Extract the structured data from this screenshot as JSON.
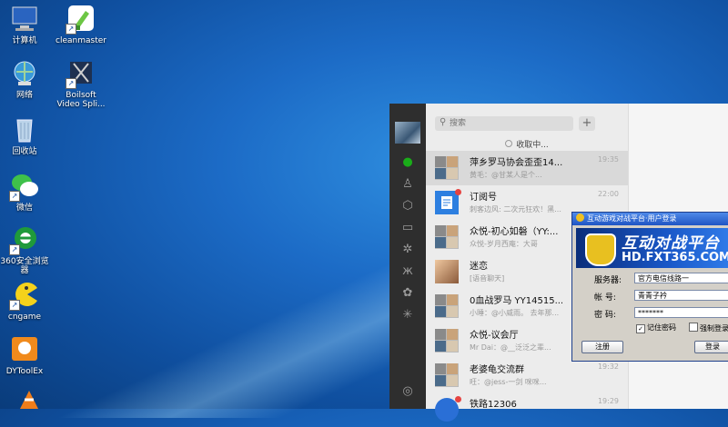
{
  "desktop": {
    "icons": [
      {
        "label": "计算机",
        "icon": "computer-icon"
      },
      {
        "label": "cleanmaster",
        "icon": "broom-icon"
      },
      {
        "label": "网络",
        "icon": "network-icon"
      },
      {
        "label": "Boilsoft\nVideo Spli...",
        "icon": "video-splitter-icon"
      },
      {
        "label": "回收站",
        "icon": "recycle-bin-icon"
      },
      {
        "label": "微信",
        "icon": "wechat-icon"
      },
      {
        "label": "360安全浏览\n器",
        "icon": "360-browser-icon"
      },
      {
        "label": "cngame",
        "icon": "pacman-icon"
      },
      {
        "label": "DYToolEx",
        "icon": "dytoolex-icon"
      }
    ]
  },
  "chat": {
    "search_placeholder": "搜索",
    "add_label": "+",
    "receiving": "收取中...",
    "conversations": [
      {
        "name": "萍乡罗马协会歪歪14...",
        "time": "19:35",
        "message": "黄毛：@甘某人是个...",
        "active": true
      },
      {
        "name": "订阅号",
        "time": "22:00",
        "message": "刺客边风: 二次元狂欢！黑... ",
        "badge": true
      },
      {
        "name": "众悦-初心如磐（YY:...",
        "time": "",
        "message": "众悦-岁月西庵：大哥"
      },
      {
        "name": "迷恋",
        "time": "",
        "message": "[语音聊天]"
      },
      {
        "name": "0血战罗马 YY14515...",
        "time": "",
        "message": "小睡：@小威雨。 去年那..."
      },
      {
        "name": "众悦-议会厅",
        "time": "",
        "message": "Mr Dai：@__泛泛之辈..."
      },
      {
        "name": "老婆龟交流群",
        "time": "19:32",
        "message": "旺：@jess-一剑 咪咪..."
      },
      {
        "name": "铁路12306",
        "time": "19:29",
        "message": ""
      }
    ]
  },
  "dialog": {
    "title": "互动游戏对战平台·用户登录",
    "banner_title": "互动对战平台",
    "banner_url": "HD.FXT365.COM",
    "server_label": "服务器:",
    "server_value": "官方电信线路一",
    "account_label": "帐  号:",
    "account_value": "青青子衿",
    "password_label": "密  码:",
    "password_value": "*******",
    "remember_label": "记住密码",
    "force_label": "强制登录",
    "register_label": "注册",
    "login_label": "登录"
  },
  "colors": {
    "desktop_blue": "#1c6bc6",
    "chat_rail": "#2e2e2e",
    "chat_green": "#1aad19",
    "badge_red": "#e64340",
    "dialog_title": "#1f55c4"
  }
}
